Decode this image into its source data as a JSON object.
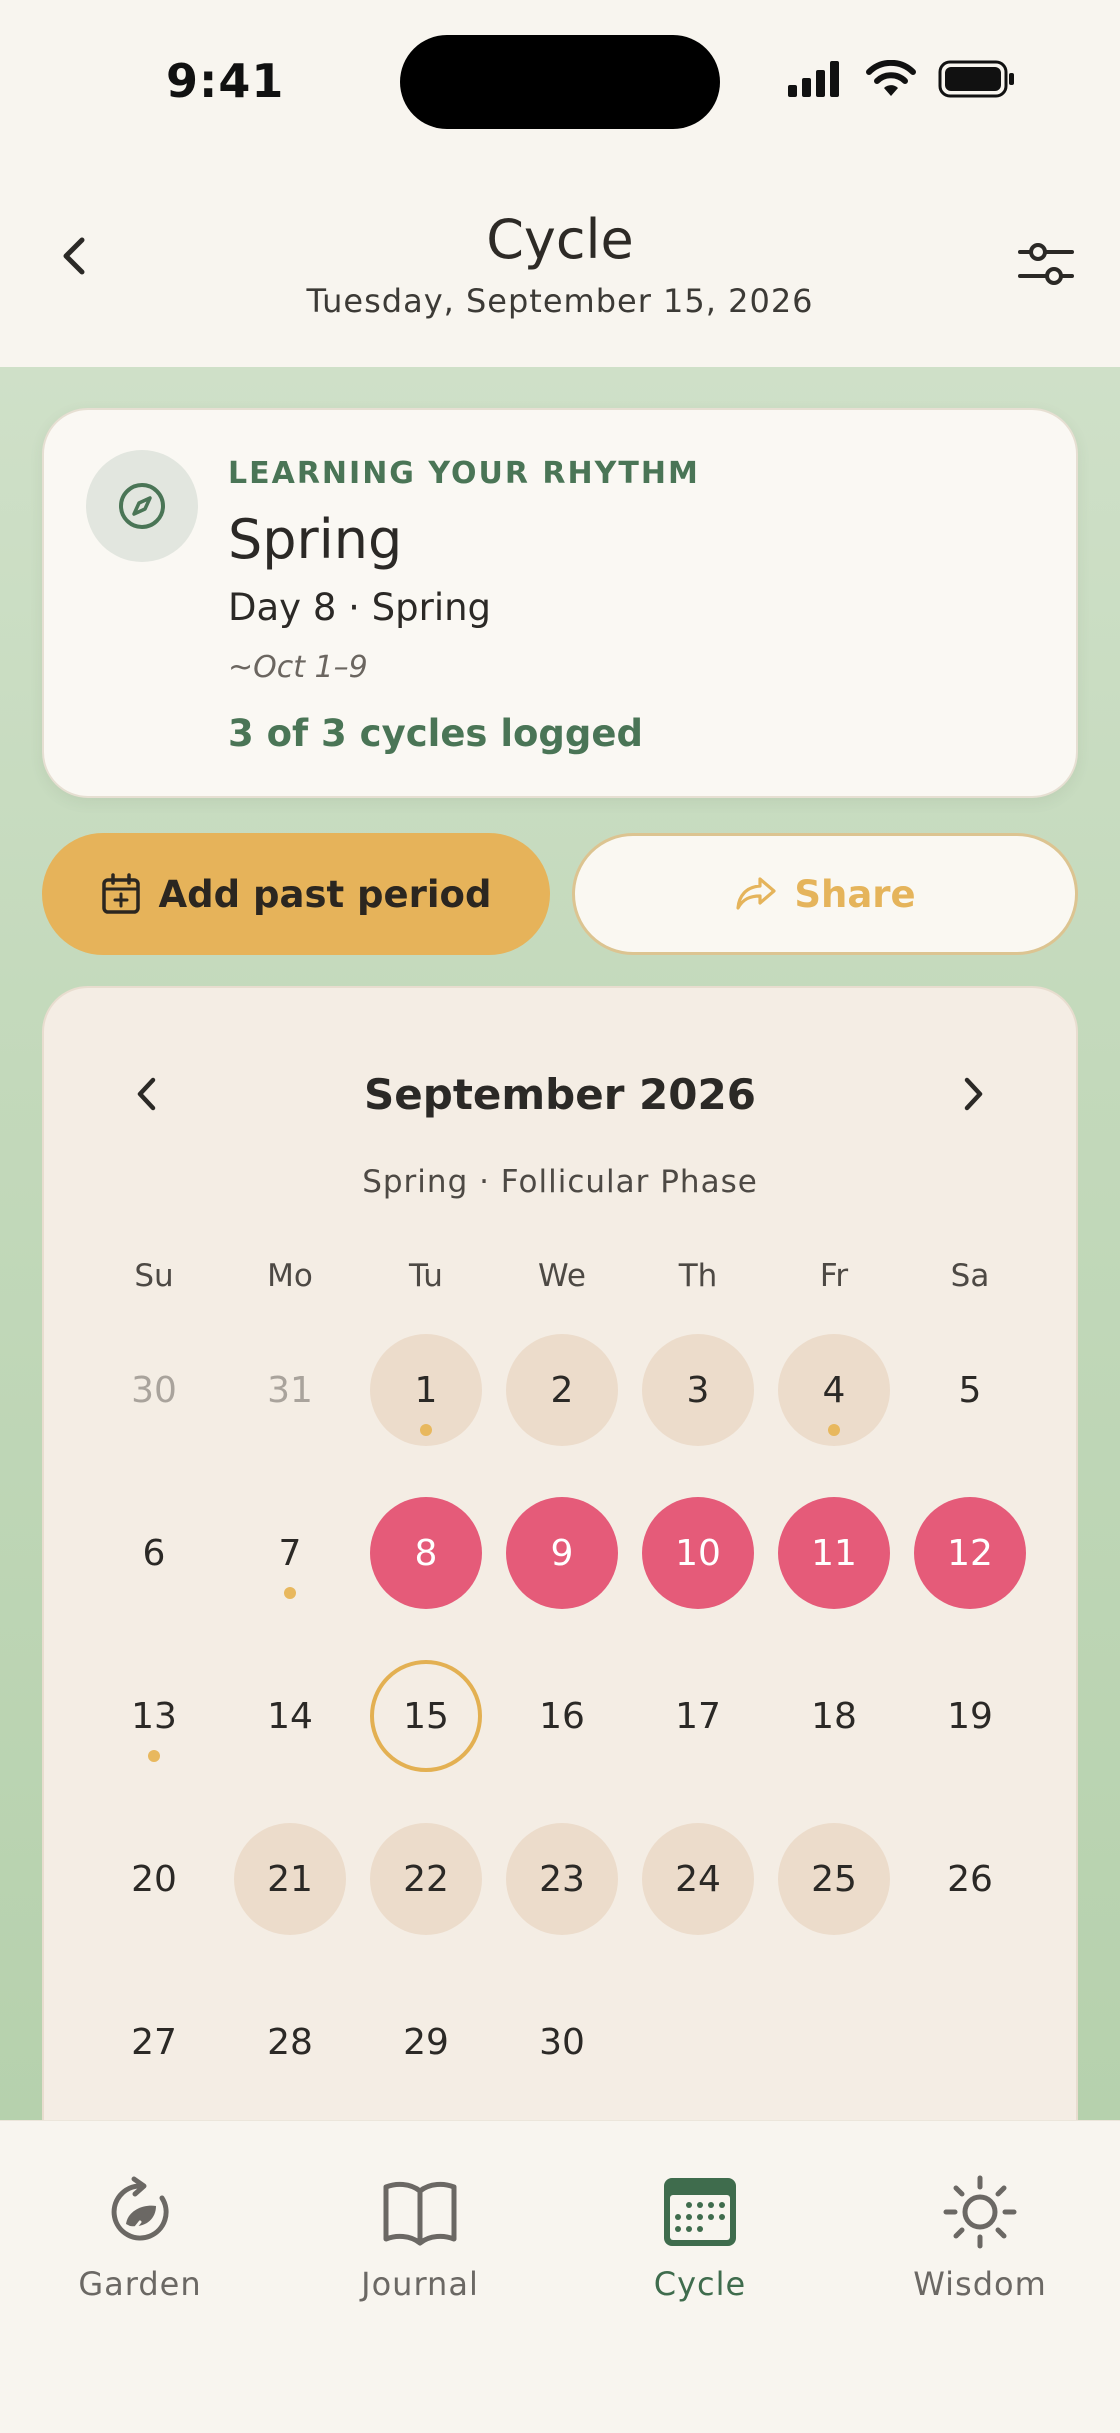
{
  "status_bar": {
    "time": "9:41"
  },
  "header": {
    "title": "Cycle",
    "subtitle": "Tuesday, September 15, 2026"
  },
  "learning_card": {
    "eyebrow": "LEARNING YOUR RHYTHM",
    "title": "Spring",
    "day_line": "Day 8 · Spring",
    "range": "~Oct 1–9",
    "logged": "3 of 3 cycles logged"
  },
  "actions": {
    "add_label": "Add past period",
    "share_label": "Share"
  },
  "calendar": {
    "month": "September 2026",
    "phase": "Spring · Follicular Phase",
    "weekdays": [
      "Su",
      "Mo",
      "Tu",
      "We",
      "Th",
      "Fr",
      "Sa"
    ],
    "weeks": [
      [
        "30",
        "31",
        "1",
        "2",
        "3",
        "4",
        "5"
      ],
      [
        "6",
        "7",
        "8",
        "9",
        "10",
        "11",
        "12"
      ],
      [
        "13",
        "14",
        "15",
        "16",
        "17",
        "18",
        "19"
      ],
      [
        "20",
        "21",
        "22",
        "23",
        "24",
        "25",
        "26"
      ],
      [
        "27",
        "28",
        "29",
        "30",
        "",
        "",
        ""
      ]
    ],
    "colors": {
      "period": "#e55b79",
      "predicted": "#ecdccb",
      "today_ring": "#e3b052",
      "marker_dot": "#e8b85e"
    }
  },
  "nav": {
    "items": [
      {
        "label": "Garden",
        "icon": "garden-cycle-icon"
      },
      {
        "label": "Journal",
        "icon": "book-icon"
      },
      {
        "label": "Cycle",
        "icon": "calendar-icon"
      },
      {
        "label": "Wisdom",
        "icon": "sun-icon"
      }
    ],
    "active_color": "#3f6c4d"
  }
}
